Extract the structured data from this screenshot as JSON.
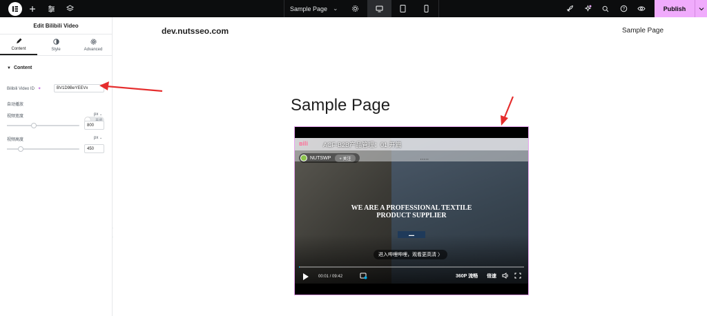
{
  "topbar": {
    "page_select": "Sample Page",
    "publish_label": "Publish"
  },
  "panel": {
    "title": "Edit Bilibili Video",
    "tabs": [
      {
        "label": "Content"
      },
      {
        "label": "Style"
      },
      {
        "label": "Advanced"
      }
    ],
    "section_label": "Content",
    "video_id_label": "Bilibili Video ID",
    "video_id_value": "BV1D9BeYEEVx",
    "autoplay_label": "自动播放",
    "autoplay_toggle_text": "关闭",
    "width_label": "视频宽度",
    "width_unit": "px",
    "width_value": "800",
    "width_slider_fraction": 0.37,
    "height_label": "视频高度",
    "height_unit": "px",
    "height_value": "450",
    "height_slider_fraction": 0.19
  },
  "canvas": {
    "site_name": "dev.nutsseo.com",
    "nav_item": "Sample Page",
    "page_title": "Sample Page",
    "video": {
      "title": "ACF-B2B产品管理：01 开篇",
      "uploader": "NUTSWP",
      "follow_label": "+ 关注",
      "hero_line1": "WE ARE A PROFESSIONAL TEXTILE",
      "hero_line2": "PRODUCT SUPPLIER",
      "cta": "进入哔哩哔哩，观看更高清 〉",
      "time": "00:01 / 09:42",
      "quality": "360P 流畅",
      "speed": "倍速",
      "progress_fraction": 0.002
    }
  },
  "colors": {
    "accent": "#f0abfc",
    "topbar_bg": "#0c0d0e",
    "arrow_red": "#e52d2d"
  }
}
